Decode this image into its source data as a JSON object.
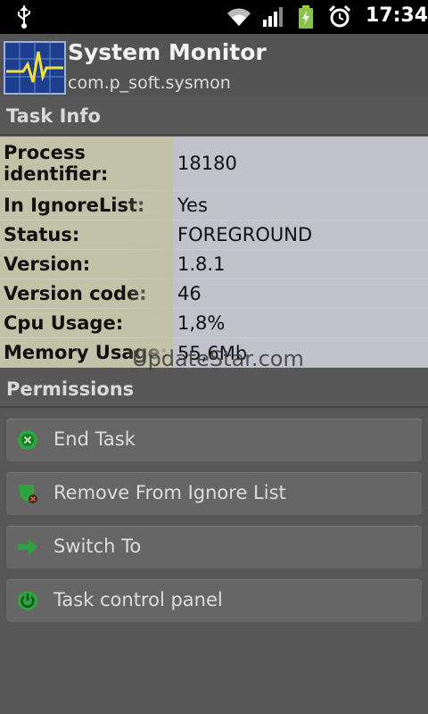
{
  "status_bar": {
    "time": "17:34",
    "icons": [
      "usb-icon",
      "wifi-icon",
      "signal-icon",
      "battery-charging-icon",
      "alarm-icon"
    ]
  },
  "header": {
    "app_name": "System Monitor",
    "package": "com.p_soft.sysmon",
    "icon": "heartbeat-monitor-icon"
  },
  "task_info": {
    "title": "Task Info",
    "rows": [
      {
        "label": "Process identifier:",
        "value": "18180"
      },
      {
        "label": "In IgnoreList:",
        "value": "Yes"
      },
      {
        "label": "Status:",
        "value": "FOREGROUND"
      },
      {
        "label": "Version:",
        "value": "1.8.1"
      },
      {
        "label": "Version code:",
        "value": "46"
      },
      {
        "label": "Cpu Usage:",
        "value": "1,8%"
      },
      {
        "label": "Memory Usage:",
        "value": "55,6Mb"
      }
    ]
  },
  "watermark": "UpdateStar.com",
  "permissions": {
    "title": "Permissions"
  },
  "actions": [
    {
      "label": "End Task",
      "icon": "close-circle-icon"
    },
    {
      "label": "Remove From Ignore List",
      "icon": "shield-remove-icon"
    },
    {
      "label": "Switch To",
      "icon": "arrow-right-icon"
    },
    {
      "label": "Task control panel",
      "icon": "power-icon"
    }
  ],
  "colors": {
    "accent_green": "#2fa33f",
    "background": "#575757",
    "label_cell": "#c2c2a8",
    "value_cell": "#c1c2cc"
  }
}
